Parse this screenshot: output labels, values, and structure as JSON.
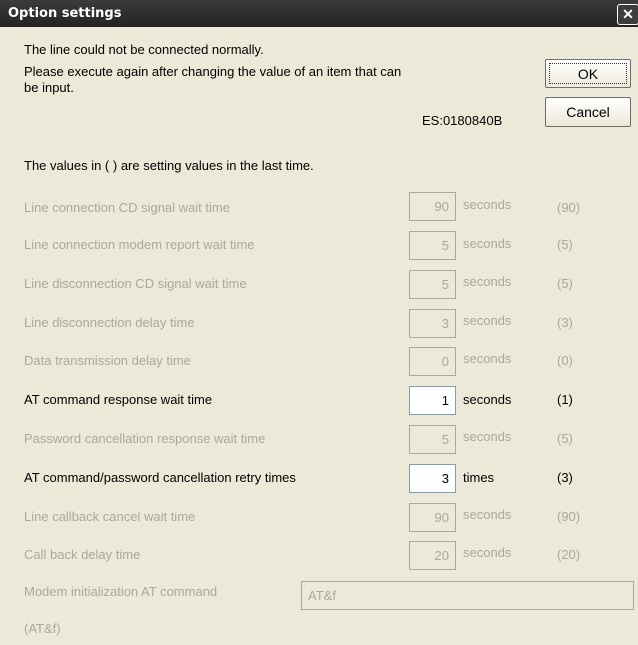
{
  "window": {
    "title": "Option settings",
    "close_glyph": "✕"
  },
  "message": {
    "line1": "The line could not be connected normally.",
    "line2": "Please execute again after changing the value of an item that can be input.",
    "error_code": "ES:0180840B",
    "note": "The values in ( ) are setting values in the last time."
  },
  "buttons": {
    "ok": "OK",
    "cancel": "Cancel"
  },
  "settings": [
    {
      "label": "Line connection CD signal wait time",
      "value": "90",
      "unit": "seconds",
      "previous": "(90)",
      "enabled": false
    },
    {
      "label": "Line connection modem report wait time",
      "value": "5",
      "unit": "seconds",
      "previous": "(5)",
      "enabled": false
    },
    {
      "label": "Line disconnection CD signal wait time",
      "value": "5",
      "unit": "seconds",
      "previous": "(5)",
      "enabled": false
    },
    {
      "label": "Line disconnection delay time",
      "value": "3",
      "unit": "seconds",
      "previous": "(3)",
      "enabled": false
    },
    {
      "label": "Data transmission delay time",
      "value": "0",
      "unit": "seconds",
      "previous": "(0)",
      "enabled": false
    },
    {
      "label": "AT command response wait time",
      "value": "1",
      "unit": "seconds",
      "previous": "(1)",
      "enabled": true
    },
    {
      "label": "Password cancellation response wait time",
      "value": "5",
      "unit": "seconds",
      "previous": "(5)",
      "enabled": false
    },
    {
      "label": "AT command/password cancellation retry times",
      "value": "3",
      "unit": "times",
      "previous": "(3)",
      "enabled": true
    },
    {
      "label": "Line callback cancel wait time",
      "value": "90",
      "unit": "seconds",
      "previous": "(90)",
      "enabled": false
    },
    {
      "label": "Call back delay time",
      "value": "20",
      "unit": "seconds",
      "previous": "(20)",
      "enabled": false
    }
  ],
  "modem_init": {
    "label": "Modem initialization AT command",
    "value": "AT&f",
    "previous": "(AT&f)",
    "enabled": false
  },
  "colors": {
    "disabled_text": "#aca899",
    "dialog_bg": "#ece9d8",
    "titlebar": "#2b2b2b"
  }
}
